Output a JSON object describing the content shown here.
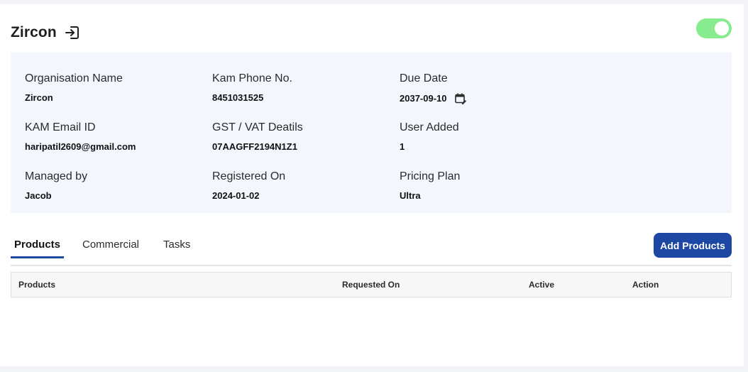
{
  "org": {
    "title": "Zircon"
  },
  "status_toggle": {
    "on": true,
    "color": "#86ec8f"
  },
  "details": {
    "organisation_name": {
      "label": "Organisation Name",
      "value": "Zircon"
    },
    "kam_phone": {
      "label": "Kam Phone No.",
      "value": "8451031525"
    },
    "due_date": {
      "label": "Due Date",
      "value": "2037-09-10"
    },
    "kam_email": {
      "label": "KAM Email ID",
      "value": "haripatil2609@gmail.com"
    },
    "gst_vat": {
      "label": "GST / VAT Deatils",
      "value": "07AAGFF2194N1Z1"
    },
    "user_added": {
      "label": "User Added",
      "value": "1"
    },
    "managed_by": {
      "label": "Managed by",
      "value": "Jacob"
    },
    "registered_on": {
      "label": "Registered On",
      "value": "2024-01-02"
    },
    "pricing_plan": {
      "label": "Pricing Plan",
      "value": "Ultra"
    }
  },
  "tabs": [
    {
      "label": "Products",
      "active": true
    },
    {
      "label": "Commercial",
      "active": false
    },
    {
      "label": "Tasks",
      "active": false
    }
  ],
  "add_products_label": "Add Products",
  "table": {
    "columns": [
      "Products",
      "Requested On",
      "Active",
      "Action"
    ],
    "rows": []
  },
  "colors": {
    "accent": "#1c48a3",
    "panel_bg": "#f3f6fd",
    "toggle_on": "#86ec8f"
  },
  "icons": {
    "header_icon": "login-icon",
    "due_date_icon": "calendar-edit-icon"
  }
}
